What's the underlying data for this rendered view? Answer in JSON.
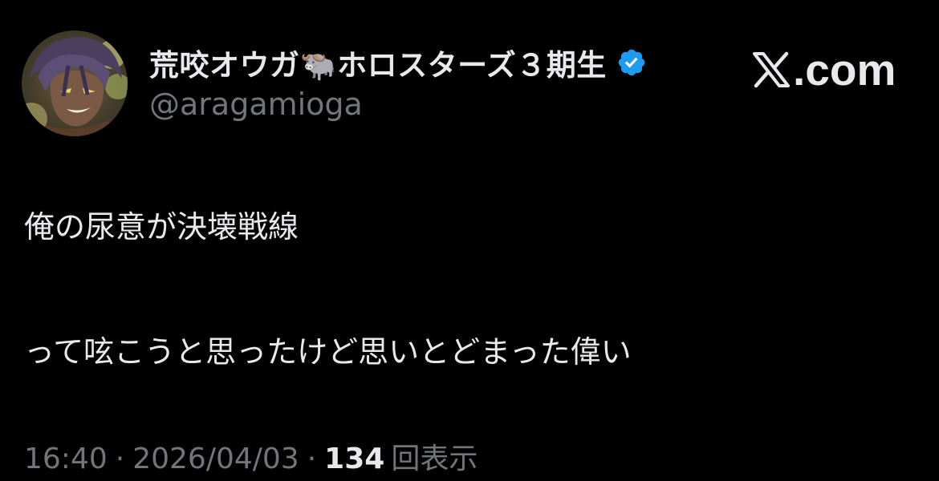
{
  "tweet": {
    "author": {
      "display_name": "荒咬オウガ🐃ホロスターズ３期生",
      "handle": "@aragamioga",
      "verified": true,
      "avatar_icon": "avatar-portrait"
    },
    "brand": {
      "logo_icon": "x-logo-icon",
      "text": ".com"
    },
    "lines": [
      "俺の尿意が決壊戦線",
      "って呟こうと思ったけど思いとどまった偉い"
    ],
    "meta": {
      "time": "16:40",
      "separator": "·",
      "date": "2026/04/03",
      "views_count": "134",
      "views_label": "回表示"
    }
  },
  "colors": {
    "background": "#000000",
    "primary_text": "#e7e9ea",
    "secondary_text": "#71767b",
    "verified_blue": "#1d9bf0"
  }
}
